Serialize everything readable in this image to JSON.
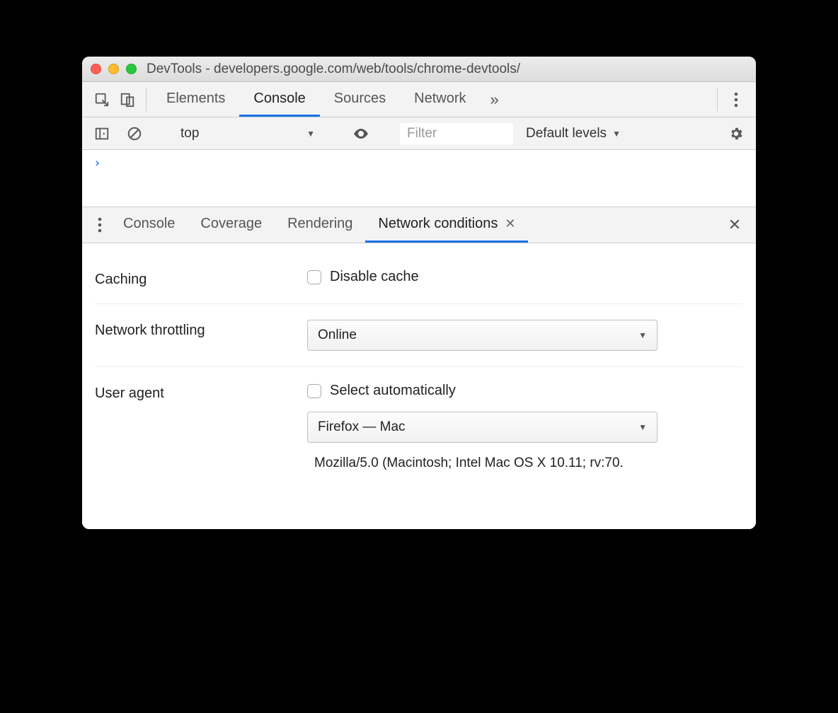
{
  "window": {
    "title": "DevTools - developers.google.com/web/tools/chrome-devtools/"
  },
  "mainTabs": {
    "elements": "Elements",
    "console": "Console",
    "sources": "Sources",
    "network": "Network"
  },
  "consoleBar": {
    "context": "top",
    "filterPlaceholder": "Filter",
    "levels": "Default levels"
  },
  "console": {
    "prompt": "›"
  },
  "drawerTabs": {
    "console": "Console",
    "coverage": "Coverage",
    "rendering": "Rendering",
    "networkConditions": "Network conditions"
  },
  "networkConditions": {
    "cachingLabel": "Caching",
    "disableCache": "Disable cache",
    "throttlingLabel": "Network throttling",
    "throttlingValue": "Online",
    "userAgentLabel": "User agent",
    "selectAuto": "Select automatically",
    "uaPreset": "Firefox — Mac",
    "uaString": "Mozilla/5.0 (Macintosh; Intel Mac OS X 10.11; rv:70."
  }
}
